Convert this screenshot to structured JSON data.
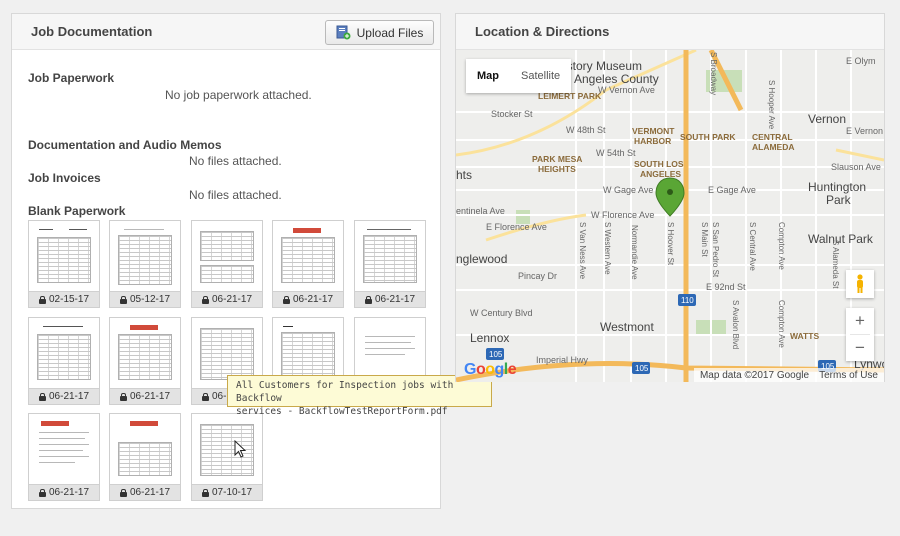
{
  "left_panel": {
    "title": "Job Documentation",
    "upload_label": "Upload Files",
    "paperwork_title": "Job Paperwork",
    "paperwork_msg": "No job paperwork attached.",
    "memos_title": "Documentation and Audio Memos",
    "memos_msg": "No files attached.",
    "invoices_title": "Job Invoices",
    "invoices_msg": "No files attached.",
    "blank_title": "Blank Paperwork",
    "thumbs": [
      {
        "date": "02-15-17"
      },
      {
        "date": "05-12-17"
      },
      {
        "date": "06-21-17"
      },
      {
        "date": "06-21-17"
      },
      {
        "date": "06-21-17"
      },
      {
        "date": "06-21-17"
      },
      {
        "date": "06-21-17"
      },
      {
        "date": "06-21-17"
      },
      {
        "date": ""
      },
      {
        "date": ""
      },
      {
        "date": "06-21-17"
      },
      {
        "date": "06-21-17"
      },
      {
        "date": "07-10-17"
      }
    ]
  },
  "tooltip": {
    "line1": "All Customers for Inspection jobs with Backflow",
    "line2": "services - BackflowTestReportForm.pdf"
  },
  "right_panel": {
    "title": "Location & Directions",
    "map": {
      "type_map": "Map",
      "type_satellite": "Satellite",
      "attribution": "Map data ©2017 Google",
      "terms": "Terms of Use",
      "google": "Google",
      "labels": {
        "museum": "istory Museum",
        "angeles_county": "Angeles County",
        "leimert": "LEIMERT PARK",
        "vernon_ave": "W Vernon Ave",
        "w48": "W 48th St",
        "vermont_harbor": "VERMONT",
        "harbor": "HARBOR",
        "south_park": "SOUTH PARK",
        "central": "CENTRAL",
        "alameda": "ALAMEDA",
        "vernon": "Vernon",
        "w54": "W 54th St",
        "park_mesa": "PARK MESA",
        "heights": "HEIGHTS",
        "south_los": "SOUTH LOS",
        "angeles": "ANGELES",
        "slauson": "Slauson Ave",
        "gage_w": "W Gage Ave",
        "gage_e": "E Gage Ave",
        "huntington": "Huntington",
        "park": "Park",
        "florence_w": "W Florence Ave",
        "florence_e": "E Florence Ave",
        "walnut_park": "Walnut Park",
        "inglewood": "nglewood",
        "pincay": "Pincay Dr",
        "e92": "E 92nd St",
        "century": "W Century Blvd",
        "lennox": "Lennox",
        "westmont": "Westmont",
        "watts": "WATTS",
        "imperial": "Imperial Hwy",
        "lynwood": "Lynwo",
        "stocker": "Stocker St",
        "hts": "hts",
        "centinela": "entinela Ave",
        "vernon_ave_e": "E Vernon Ave",
        "hwy110": "110",
        "hwy105a": "105",
        "hwy105b": "105",
        "hwy105c": "105",
        "hoover": "S Hoover St",
        "normandie": "Normandie Ave",
        "western": "S Western Ave",
        "van_ness": "S Van Ness Ave",
        "san_pedro": "S San Pedro St",
        "main": "S Main St",
        "central_ave": "S Central Ave",
        "compton_ave": "Compton Ave",
        "avalon": "S Avalon Blvd",
        "hooper": "S Hooper Ave",
        "alameda_st": "S Alameda St",
        "broadway": "S Broadway",
        "olympic": "E Olym"
      }
    }
  }
}
